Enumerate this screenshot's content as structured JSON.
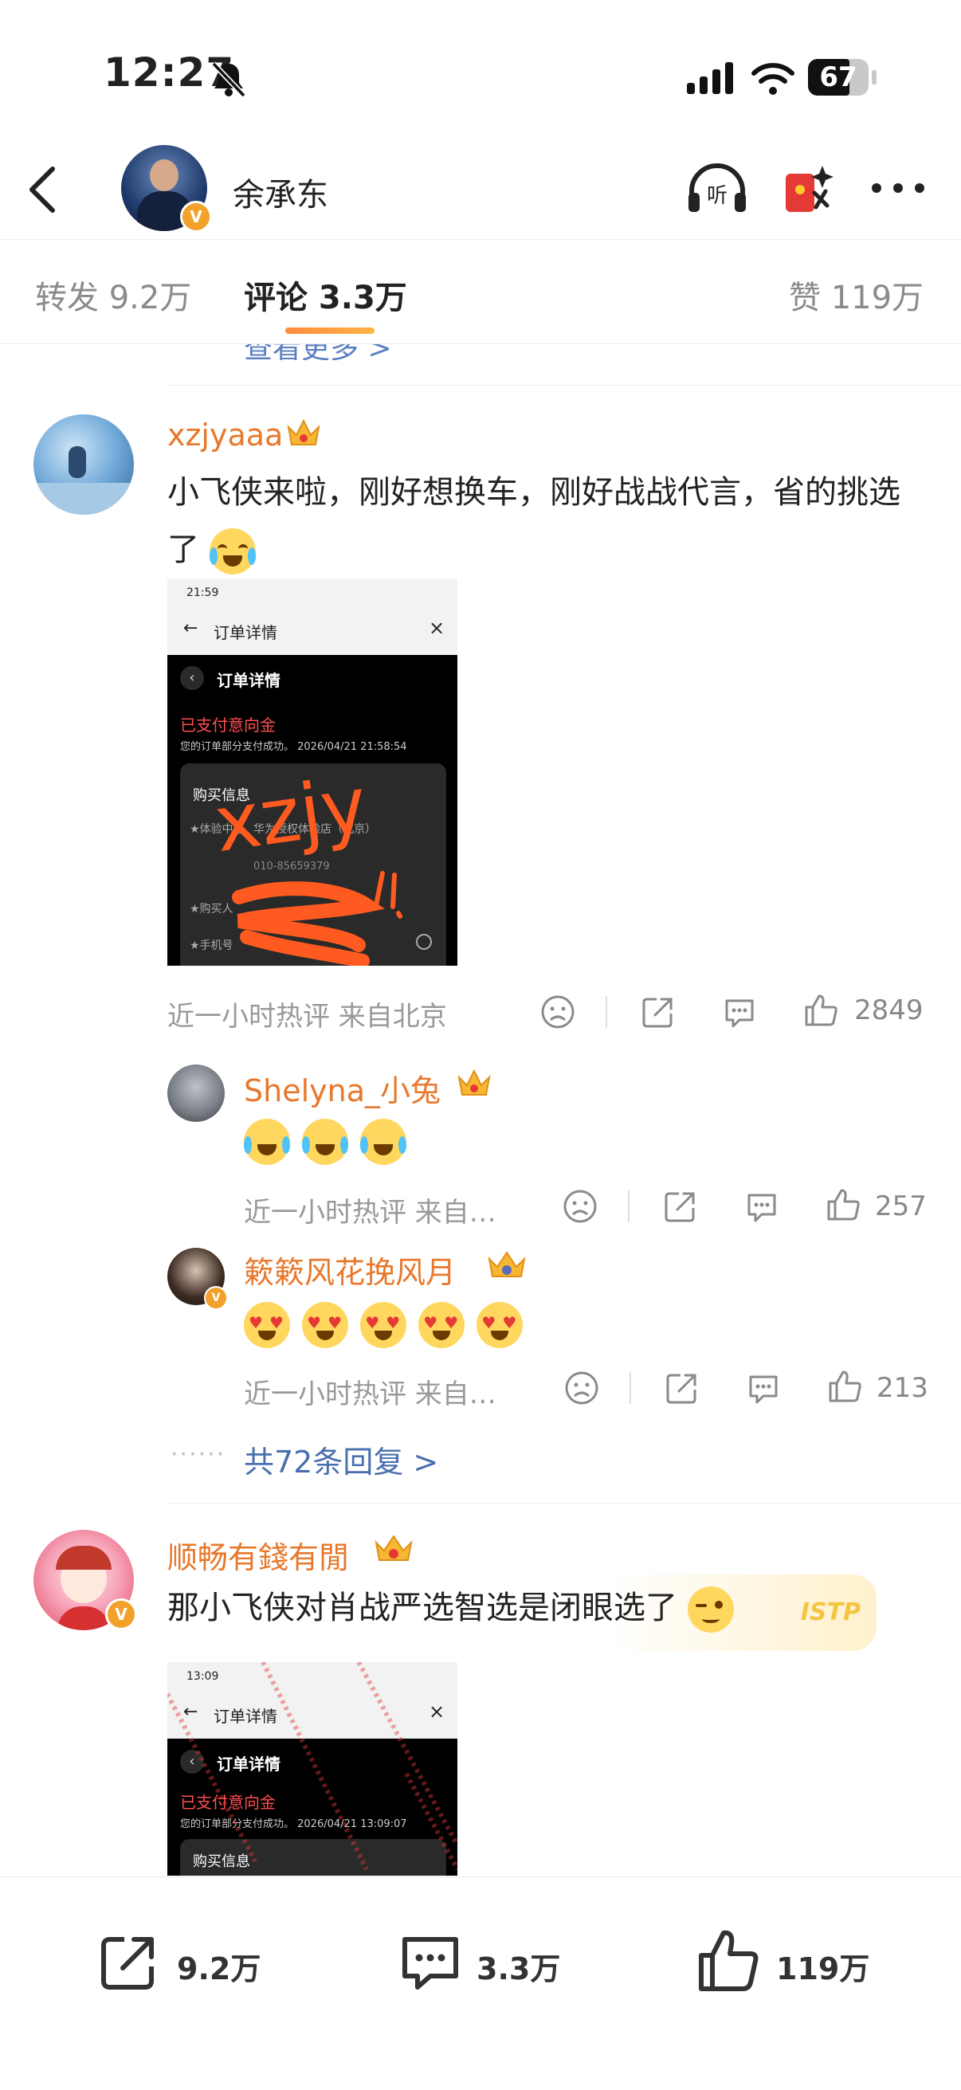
{
  "status": {
    "time": "12:27",
    "battery": "67"
  },
  "header": {
    "username": "余承东"
  },
  "tabs": {
    "repost": "转发 9.2万",
    "comment": "评论 3.3万",
    "like": "赞 119万"
  },
  "more_link": "查看更多 >",
  "comment1": {
    "user": "xzjyaaa",
    "text": "小飞侠来啦，刚好想换车，刚好战战代言，省的挑选了",
    "meta": "近一小时热评 来自北京",
    "likes": "2849",
    "image": {
      "time": "21:59",
      "bar_title": "订单详情",
      "page_title": "订单详情",
      "status": "已支付意向金",
      "desc": "您的订单部分支付成功。 2026/04/21 21:58:54",
      "section": "购买信息",
      "row1": "★体验中心",
      "row1_val": "华为授权体验店（北京）",
      "phone": "010-85659379",
      "row2": "★购买人",
      "row3": "★手机号",
      "scribble": "xzjy"
    }
  },
  "reply1": {
    "user": "Shelyna_小兔",
    "meta": "近一小时热评 来自…",
    "likes": "257"
  },
  "reply2": {
    "user": "簌簌风花挽风月",
    "meta": "近一小时热评 来自…",
    "likes": "213"
  },
  "replies_link": "共72条回复 >",
  "comment2": {
    "user": "顺畅有錢有閒",
    "text": "那小飞侠对肖战严选智选是闭眼选了",
    "sticker": "ISTP",
    "image": {
      "time": "13:09",
      "bar_title": "订单详情",
      "page_title": "订单详情",
      "status": "已支付意向金",
      "desc": "您的订单部分支付成功。 2026/04/21 13:09:07",
      "section": "购买信息"
    }
  },
  "bottom": {
    "repost": "9.2万",
    "comment": "3.3万",
    "like": "119万"
  }
}
